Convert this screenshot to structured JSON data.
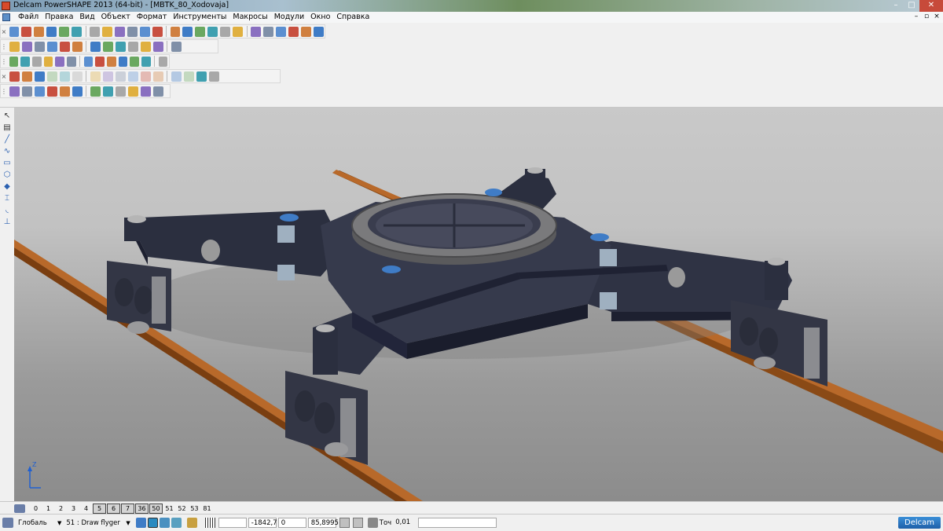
{
  "window": {
    "title": "Delcam PowerSHAPE 2013 (64-bit) - [MBTK_80_Xodovaja]",
    "minimize": "–",
    "maximize": "□",
    "close": "✕"
  },
  "menu": {
    "items": [
      "Файл",
      "Правка",
      "Вид",
      "Объект",
      "Формат",
      "Инструменты",
      "Макросы",
      "Модули",
      "Окно",
      "Справка"
    ],
    "doc_controls": [
      "–",
      "▫",
      "×"
    ]
  },
  "toolbars": {
    "rows": [
      {
        "icons": [
          "new-icon",
          "open-icon",
          "open-model-icon",
          "save-icon",
          "save-as-icon",
          "print-icon",
          "cut-icon",
          "copy-icon",
          "paste-icon",
          "delete-icon",
          "erase-icon",
          "undo-icon",
          "redo-icon",
          "text-icon",
          "transform-icon",
          "pick-icon",
          "select-box-icon",
          "circle-icon",
          "curve-icon",
          "text-tool-icon",
          "surface-icon",
          "solid-icon",
          "component-icon",
          "wizard-icon"
        ]
      },
      {
        "icons": [
          "view-top-icon",
          "view-front-icon",
          "view-right-icon",
          "view-iso-icon",
          "pan-icon",
          "zoom-icon",
          "zoom-in-icon",
          "zoom-fit-icon",
          "shade-icon",
          "wireframe-icon",
          "hidden-icon",
          "light-icon",
          "hand-icon"
        ]
      },
      {
        "icons": [
          "layer-icon",
          "doc-icon",
          "surface-icon",
          "solid-icon",
          "shaded-icon",
          "sphere-icon",
          "cone-icon",
          "cube-icon",
          "box-icon",
          "extrude-icon",
          "revolve-icon",
          "blend-icon",
          "sweep-icon"
        ]
      },
      {
        "icons": [
          "select-icon",
          "face-icon",
          "cube-icon",
          "blend-icon",
          "loft-icon",
          "round-icon",
          "corner-icon",
          "shell-icon",
          "boolean-icon",
          "add-icon",
          "cut-icon",
          "feature-icon",
          "history-icon",
          "view-icon",
          "shell-2-icon",
          "mesh-icon"
        ]
      },
      {
        "icons": [
          "analysis-icon",
          "measure-icon",
          "solid-icon",
          "solid-shade-icon",
          "solid-box-icon",
          "assembly-icon",
          "mate-icon",
          "part-icon",
          "drawing-icon",
          "sheet-icon",
          "detail-icon",
          "section-icon"
        ]
      }
    ]
  },
  "sidebar": {
    "tools": [
      "select-arrow-icon",
      "selection-filter-icon",
      "line-icon",
      "arc-icon",
      "rectangle-icon",
      "polygon-icon",
      "solid-cube-icon",
      "i-beam-icon",
      "curve-tool-icon",
      "dimension-icon"
    ]
  },
  "viewport": {
    "scene": "bogie-frame-on-rails",
    "colors": {
      "rail": "#a35a1e",
      "frame": "#2f3344",
      "ring": "#6e6e70",
      "pad": "#3f7cc6",
      "background_top": "#c9c9c9",
      "background_bottom": "#8c8c8c"
    },
    "axis_label": "Z"
  },
  "levels": {
    "items": [
      {
        "label": "0",
        "boxed": false
      },
      {
        "label": "1",
        "boxed": false
      },
      {
        "label": "2",
        "boxed": false
      },
      {
        "label": "3",
        "boxed": false
      },
      {
        "label": "4",
        "boxed": false
      },
      {
        "label": "5",
        "boxed": true
      },
      {
        "label": "6",
        "boxed": true
      },
      {
        "label": "7",
        "boxed": true
      },
      {
        "label": "36",
        "boxed": true
      },
      {
        "label": "50",
        "boxed": true
      },
      {
        "label": "51",
        "boxed": false
      },
      {
        "label": "52",
        "boxed": false
      },
      {
        "label": "53",
        "boxed": false
      },
      {
        "label": "81",
        "boxed": false
      }
    ]
  },
  "status": {
    "workplane": "Глобаль",
    "level": "51 : Draw flyger",
    "x": "-1842,7",
    "y": "0",
    "z": "85,8995",
    "tolerance_label": "Точ",
    "tolerance": "0,01",
    "brand": "Delcam"
  }
}
